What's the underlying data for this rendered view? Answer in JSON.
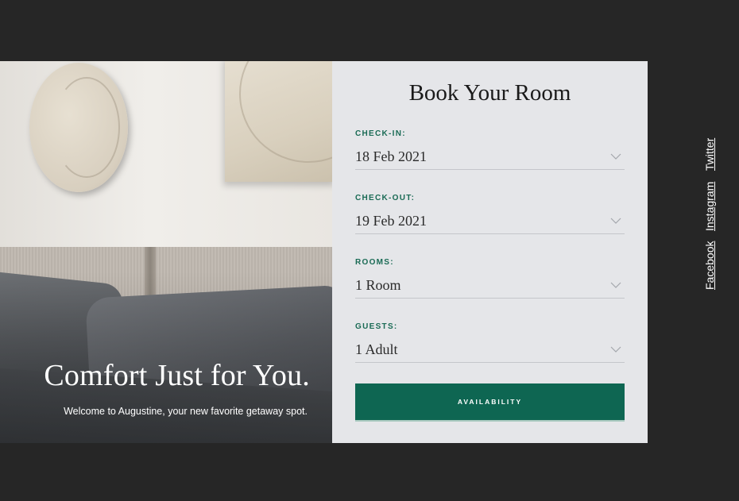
{
  "hero": {
    "title": "Comfort Just for You.",
    "subtitle": "Welcome to Augustine, your new favorite getaway spot."
  },
  "booking": {
    "title": "Book Your Room",
    "fields": [
      {
        "label": "CHECK-IN:",
        "value": "18 Feb 2021",
        "icon": "chevron-down-icon"
      },
      {
        "label": "CHECK-OUT:",
        "value": "19 Feb 2021",
        "icon": "chevron-down-icon"
      },
      {
        "label": "ROOMS:",
        "value": "1 Room",
        "icon": "chevron-down-icon"
      },
      {
        "label": "GUESTS:",
        "value": "1 Adult",
        "icon": "chevron-down-icon"
      }
    ],
    "button_label": "AVAILABILITY"
  },
  "social": [
    "Twitter",
    "Instagram",
    "Facebook"
  ],
  "colors": {
    "page_background": "#262626",
    "form_background": "#e5e6e9",
    "accent": "#0e6652",
    "label_color": "#1a6b55"
  }
}
